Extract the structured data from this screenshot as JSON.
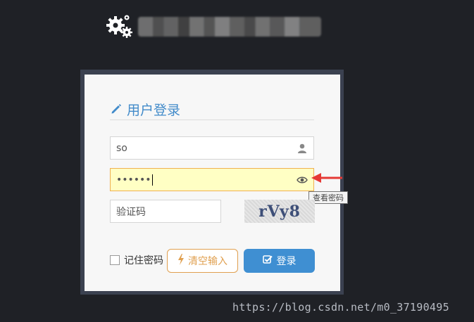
{
  "header": {
    "title": ""
  },
  "login": {
    "title": "用户登录",
    "username_value": "so",
    "password_mask": "••••••",
    "captcha_placeholder": "验证码",
    "captcha_code": "rVy8",
    "remember_label": "记住密码",
    "clear_label": "清空输入",
    "login_label": "登录",
    "show_password_tooltip": "查看密码"
  },
  "watermark": "https://blog.csdn.net/m0_37190495",
  "colors": {
    "accent": "#428bca",
    "login_button": "#3f8fd2",
    "clear_button": "#e0a050",
    "background": "#1f2126"
  }
}
